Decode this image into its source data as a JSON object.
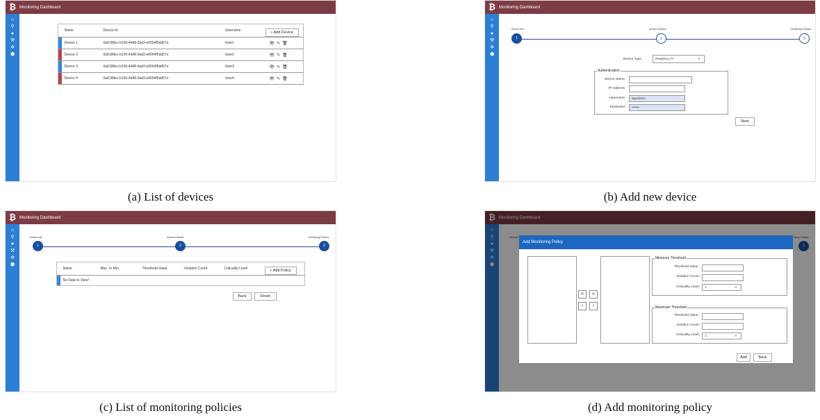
{
  "app": {
    "title": "Monitoring Dashboard",
    "logo_glyph": "₿"
  },
  "sidebar_icons": [
    "home-icon",
    "search-icon",
    "user-icon",
    "wrench-icon",
    "gear-icon",
    "hexagon-icon"
  ],
  "sidebar_glyphs": [
    "⌂",
    "⚲",
    "●",
    "⚒",
    "✲",
    "⬢"
  ],
  "captions": {
    "a": "(a) List of devices",
    "b": "(b) Add new device",
    "c": "(c) List of monitoring policies",
    "d": "(d) Add monitoring policy"
  },
  "devices": {
    "headers": {
      "name": "Name",
      "id": "Device Id",
      "user": "Username"
    },
    "add_label": "Add Device",
    "plus": "+",
    "rows": [
      {
        "name": "Device 1",
        "id": "0a6188ec-b156-4d48-9ad3-e6564f5dd57e",
        "user": "User1",
        "color": "#3a85d6"
      },
      {
        "name": "Device 2",
        "id": "0a6188ec-b156-4d48-9ad3-e6564f5dd57e",
        "user": "User2",
        "color": "#b5454f"
      },
      {
        "name": "Device 3",
        "id": "0a6188ec-b156-4d48-9ad3-e6564f5dd57e",
        "user": "User3",
        "color": "#3a85d6"
      },
      {
        "name": "Device 4",
        "id": "0a6188ec-b156-4d48-9ad3-e6564f5dd57e",
        "user": "User4",
        "color": "#b5454f"
      }
    ],
    "action_glyphs": [
      "👁",
      "✎",
      "🗑"
    ]
  },
  "steps": {
    "labels": [
      "Device Info",
      "Access Policies",
      "Monitoring Policies"
    ],
    "numbers": [
      "1",
      "2",
      "3"
    ]
  },
  "add_device": {
    "device_type_label": "Device Type",
    "device_type_value": "Raspberry Pi",
    "auth_legend": "Authentication",
    "fields": [
      {
        "label": "Device Name:",
        "value": ""
      },
      {
        "label": "IP Address:",
        "value": ""
      },
      {
        "label": "Username:",
        "value": "appadmin"
      },
      {
        "label": "Password:",
        "value": "•••••••"
      }
    ],
    "next_label": "Next"
  },
  "policies": {
    "headers": [
      "Name",
      "Max. or Min.",
      "Threshold Value",
      "Violation Count",
      "Criticality Level"
    ],
    "add_label": "Add Policy",
    "plus": "+",
    "empty_text": "No Data to View!",
    "back_label": "Back",
    "finish_label": "Finish"
  },
  "add_policy": {
    "title": "Add Monitoring Policy",
    "min_legend": "Minimum Threshold",
    "max_legend": "Maximum Threshold",
    "threshold_label": "Threshold Value :",
    "violation_label": "Violation Count:",
    "criticality_label": "Criticality Level:",
    "criticality_value": "1",
    "arrows": [
      "«",
      "»",
      "‹",
      "›"
    ],
    "add_label": "Add",
    "back_label": "Back"
  },
  "colors": {
    "topbar": "#7d3b45",
    "sidebar": "#2d7fd3",
    "accent": "#1a4fa0"
  }
}
